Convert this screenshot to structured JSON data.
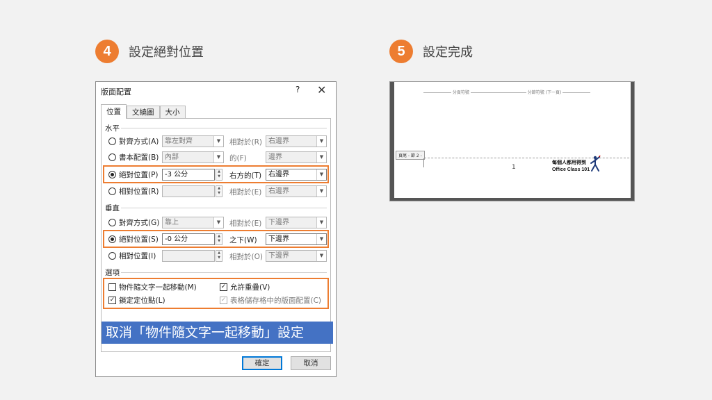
{
  "steps": [
    {
      "number": "4",
      "title": "設定絕對位置"
    },
    {
      "number": "5",
      "title": "設定完成"
    }
  ],
  "dialog": {
    "title": "版面配置",
    "help": "?",
    "close": "✕",
    "tabs": [
      "位置",
      "文繞圖",
      "大小"
    ],
    "horizontal": {
      "heading": "水平",
      "rows": [
        {
          "option": "對齊方式(A)",
          "value": "靠左對齊",
          "rel_label": "相對於(R)",
          "rel_value": "右邊界",
          "selected": false
        },
        {
          "option": "書本配置(B)",
          "value": "內部",
          "rel_label": "的(F)",
          "rel_value": "邊界",
          "selected": false
        },
        {
          "option": "絕對位置(P)",
          "value": "-3 公分",
          "rel_label": "右方的(T)",
          "rel_value": "右邊界",
          "selected": true
        },
        {
          "option": "相對位置(R)",
          "value": "",
          "rel_label": "相對於(E)",
          "rel_value": "右邊界",
          "selected": false
        }
      ]
    },
    "vertical": {
      "heading": "垂直",
      "rows": [
        {
          "option": "對齊方式(G)",
          "value": "靠上",
          "rel_label": "相對於(E)",
          "rel_value": "下邊界",
          "selected": false
        },
        {
          "option": "絕對位置(S)",
          "value": "-0 公分",
          "rel_label": "之下(W)",
          "rel_value": "下邊界",
          "selected": true
        },
        {
          "option": "相對位置(I)",
          "value": "",
          "rel_label": "相對於(O)",
          "rel_value": "下邊界",
          "selected": false
        }
      ]
    },
    "options": {
      "heading": "選項",
      "move_with_text": "物件隨文字一起移動(M)",
      "allow_overlap": "允許重疊(V)",
      "lock_anchor": "鎖定定位點(L)",
      "layout_in_table": "表格儲存格中的版面配置(C)"
    },
    "checkboxes": {
      "move_with_text": false,
      "allow_overlap": true,
      "lock_anchor": true,
      "layout_in_table": true
    },
    "ok_label": "確定",
    "cancel_label": "取消"
  },
  "banner": "取消「物件隨文字一起移動」設定",
  "document": {
    "section_break": "分頁符號",
    "section_break_next": "分節符號 (下一頁)",
    "footer_tab": "頁尾 - 節 2 -",
    "cursor": "1",
    "footer_line1": "每個人都用得到",
    "footer_line2": "Office Class 101"
  },
  "colors": {
    "accent": "#ed7d31",
    "banner": "#4472c4"
  }
}
